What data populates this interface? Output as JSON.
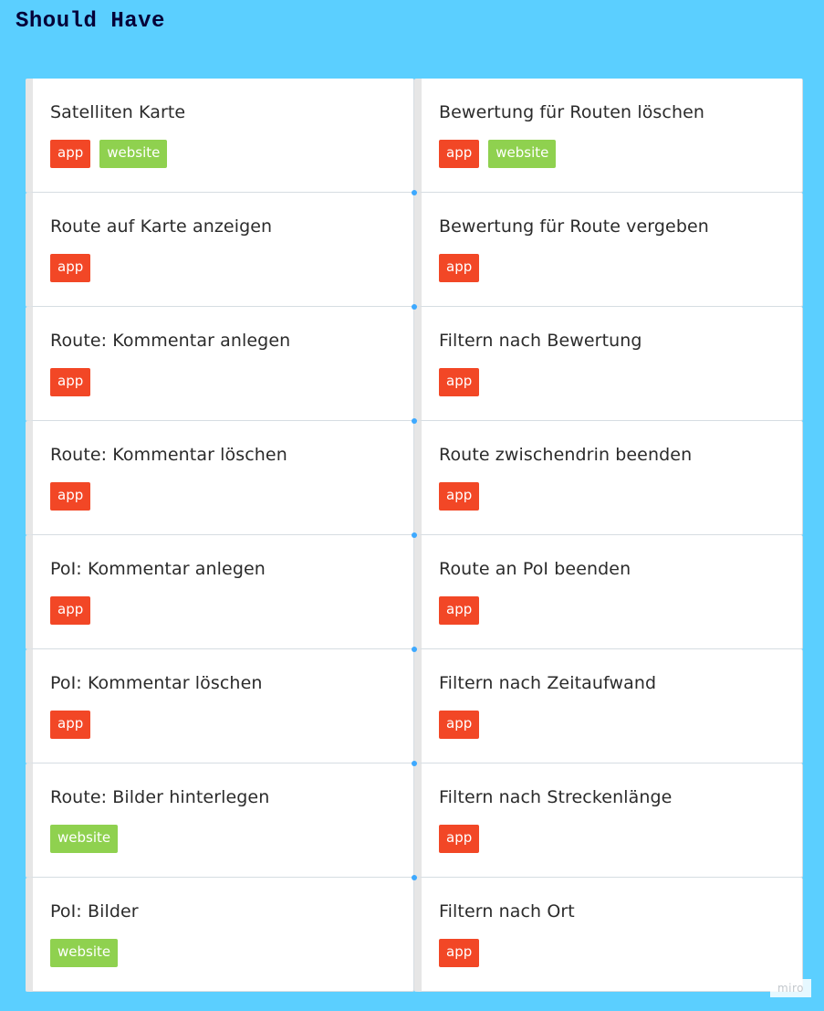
{
  "frame": {
    "title": "Should Have"
  },
  "tag_colors": {
    "app": "#f24726",
    "website": "#8fd14f"
  },
  "cards": [
    {
      "title": "Satelliten Karte",
      "tags": [
        "app",
        "website"
      ]
    },
    {
      "title": "Bewertung für Routen löschen",
      "tags": [
        "app",
        "website"
      ]
    },
    {
      "title": "Route auf Karte anzeigen",
      "tags": [
        "app"
      ]
    },
    {
      "title": "Bewertung für Route vergeben",
      "tags": [
        "app"
      ]
    },
    {
      "title": "Route: Kommentar anlegen",
      "tags": [
        "app"
      ]
    },
    {
      "title": "Filtern nach Bewertung",
      "tags": [
        "app"
      ]
    },
    {
      "title": "Route: Kommentar löschen",
      "tags": [
        "app"
      ]
    },
    {
      "title": "Route zwischendrin beenden",
      "tags": [
        "app"
      ]
    },
    {
      "title": "PoI: Kommentar anlegen",
      "tags": [
        "app"
      ]
    },
    {
      "title": "Route an PoI beenden",
      "tags": [
        "app"
      ]
    },
    {
      "title": "PoI: Kommentar löschen",
      "tags": [
        "app"
      ]
    },
    {
      "title": "Filtern nach Zeitaufwand",
      "tags": [
        "app"
      ]
    },
    {
      "title": "Route: Bilder hinterlegen",
      "tags": [
        "website"
      ]
    },
    {
      "title": "Filtern nach Streckenlänge",
      "tags": [
        "app"
      ]
    },
    {
      "title": "PoI: Bilder",
      "tags": [
        "website"
      ]
    },
    {
      "title": "Filtern nach Ort",
      "tags": [
        "app"
      ]
    }
  ],
  "watermark": {
    "text": "miro"
  }
}
